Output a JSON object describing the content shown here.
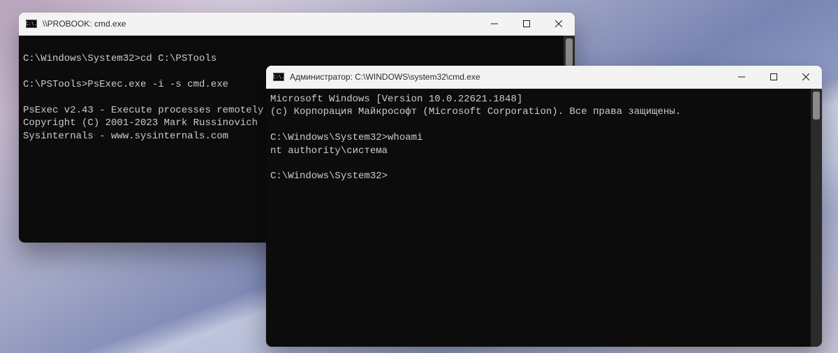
{
  "window1": {
    "title": "\\\\PROBOOK: cmd.exe",
    "lines": [
      "",
      "C:\\Windows\\System32>cd C:\\PSTools",
      "",
      "C:\\PSTools>PsExec.exe -i -s cmd.exe",
      "",
      "PsExec v2.43 - Execute processes remotely",
      "Copyright (C) 2001-2023 Mark Russinovich",
      "Sysinternals - www.sysinternals.com",
      ""
    ]
  },
  "window2": {
    "title": "Администратор: C:\\WINDOWS\\system32\\cmd.exe",
    "lines": [
      "Microsoft Windows [Version 10.0.22621.1848]",
      "(c) Корпорация Майкрософт (Microsoft Corporation). Все права защищены.",
      "",
      "C:\\Windows\\System32>whoami",
      "nt authority\\система",
      "",
      "C:\\Windows\\System32>"
    ]
  },
  "icon_glyph": "C:\\."
}
